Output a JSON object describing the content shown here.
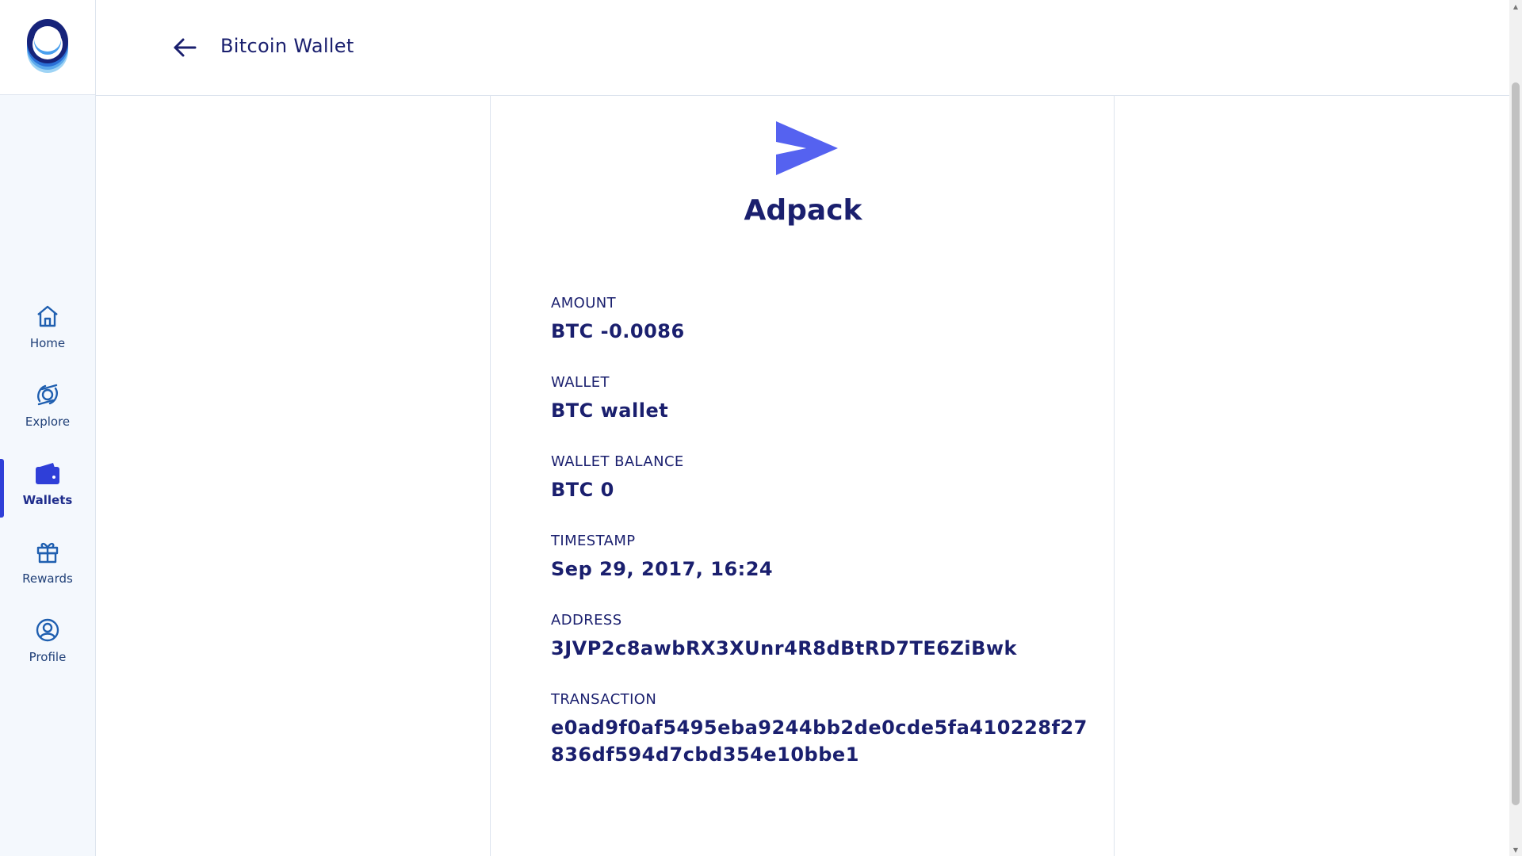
{
  "header": {
    "title": "Bitcoin Wallet"
  },
  "sidebar": {
    "items": [
      {
        "label": "Home",
        "icon": "home-icon",
        "active": false
      },
      {
        "label": "Explore",
        "icon": "explore-icon",
        "active": false
      },
      {
        "label": "Wallets",
        "icon": "wallet-icon",
        "active": true
      },
      {
        "label": "Rewards",
        "icon": "gift-icon",
        "active": false
      },
      {
        "label": "Profile",
        "icon": "profile-icon",
        "active": false
      }
    ]
  },
  "transaction": {
    "title": "Adpack",
    "icon": "send-icon",
    "fields": {
      "amount": {
        "label": "AMOUNT",
        "value": "BTC -0.0086"
      },
      "wallet": {
        "label": "WALLET",
        "value": "BTC wallet"
      },
      "wallet_balance": {
        "label": "WALLET BALANCE",
        "value": "BTC 0"
      },
      "timestamp": {
        "label": "TIMESTAMP",
        "value": "Sep 29, 2017, 16:24"
      },
      "address": {
        "label": "ADDRESS",
        "value": "3JVP2c8awbRX3XUnr4R8dBtRD7TE6ZiBwk"
      },
      "transaction": {
        "label": "TRANSACTION",
        "value": "e0ad9f0af5495eba9244bb2de0cde5fa410228f27836df594d7cbd354e10bbe1"
      }
    }
  },
  "colors": {
    "accent": "#5562f0",
    "text": "#1a1f6e",
    "active_indicator": "#2f3fd8",
    "sidebar_bg": "#f4f8fd"
  }
}
